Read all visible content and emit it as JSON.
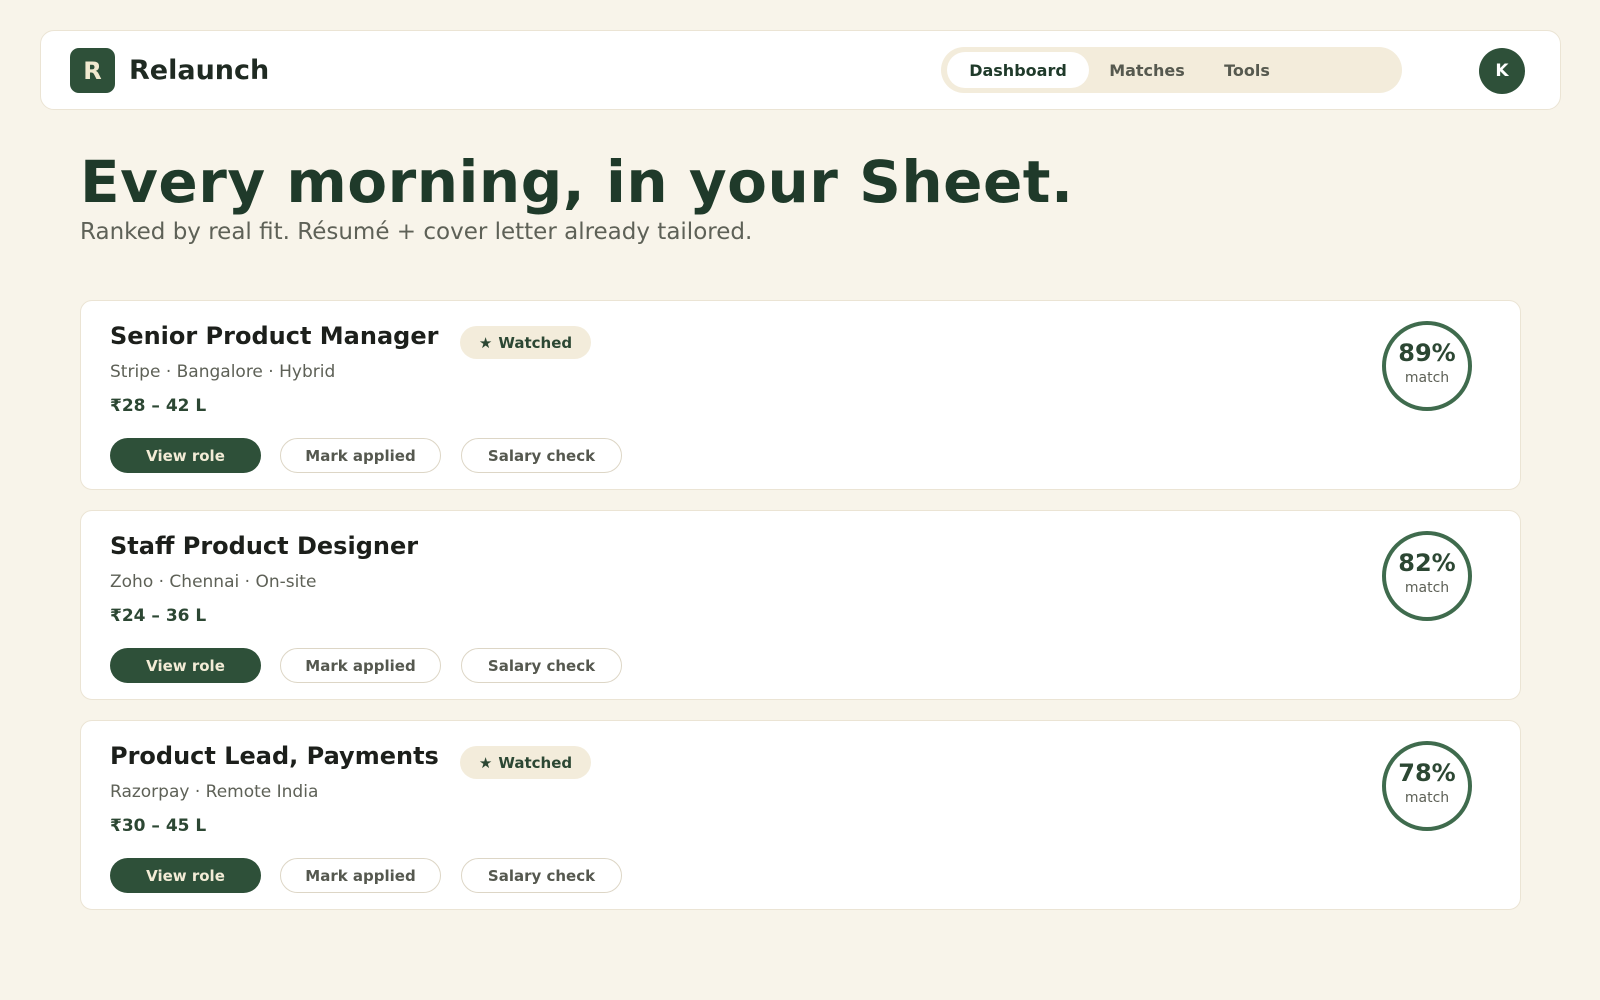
{
  "header": {
    "logo_letter": "R",
    "brand": "Relaunch",
    "nav": [
      {
        "label": "Dashboard",
        "active": true
      },
      {
        "label": "Matches",
        "active": false
      },
      {
        "label": "Tools",
        "active": false
      }
    ],
    "avatar_initial": "K"
  },
  "hero": {
    "title": "Every morning, in your Sheet.",
    "subtitle": "Ranked by real fit. Résumé + cover letter already tailored."
  },
  "jobs": [
    {
      "title": "Senior Product Manager",
      "watched": true,
      "watched_label": "Watched",
      "meta": "Stripe · Bangalore · Hybrid",
      "salary": "₹28 – 42 L",
      "view_label": "View role",
      "applied_label": "Mark applied",
      "salary_check_label": "Salary check",
      "match_pct": "89%",
      "match_value": 89,
      "match_label": "match"
    },
    {
      "title": "Staff Product Designer",
      "watched": false,
      "watched_label": "",
      "meta": "Zoho · Chennai · On-site",
      "salary": "₹24 – 36 L",
      "view_label": "View role",
      "applied_label": "Mark applied",
      "salary_check_label": "Salary check",
      "match_pct": "82%",
      "match_value": 82,
      "match_label": "match"
    },
    {
      "title": "Product Lead, Payments",
      "watched": true,
      "watched_label": "Watched",
      "meta": "Razorpay · Remote India",
      "salary": "₹30 – 45 L",
      "view_label": "View role",
      "applied_label": "Mark applied",
      "salary_check_label": "Salary check",
      "match_pct": "78%",
      "match_value": 78,
      "match_label": "match"
    }
  ],
  "colors": {
    "accent": "#2e5039",
    "background": "#f8f4ea",
    "badge": "#f3ecdb"
  },
  "icons": {
    "watched": "star-icon"
  }
}
